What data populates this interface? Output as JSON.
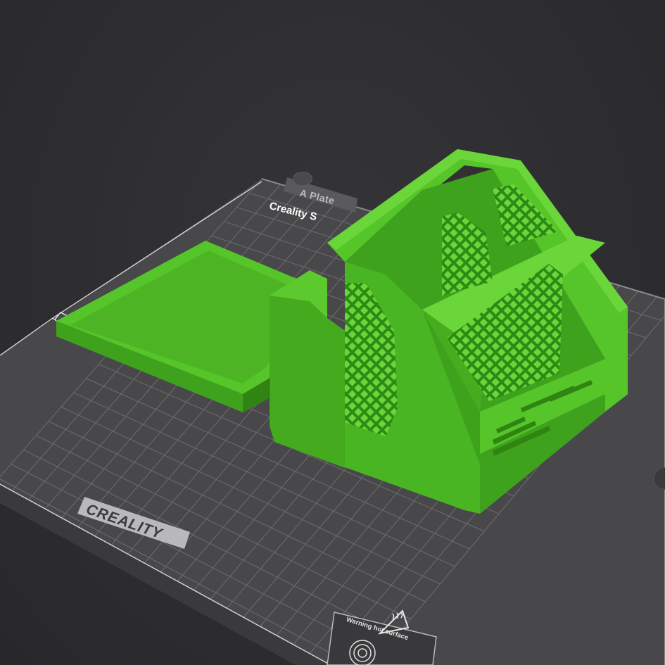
{
  "plate": {
    "name": "A Plate",
    "brand_top": "Creality S",
    "brand_bottom": "CREALITY",
    "warning": "Warning hot surface"
  },
  "icons": {
    "edit": "pencil-icon",
    "home": "home-icon",
    "hot_surface": "hot-surface-warning-icon",
    "fingerprint": "fingerprint-icon"
  },
  "colors": {
    "background": "#2e2e31",
    "plate": "#48484b",
    "grid": "#7a7a7d",
    "model": "#55c52a",
    "model_shade": "#3fa21c",
    "model_dark": "#2f8412"
  }
}
